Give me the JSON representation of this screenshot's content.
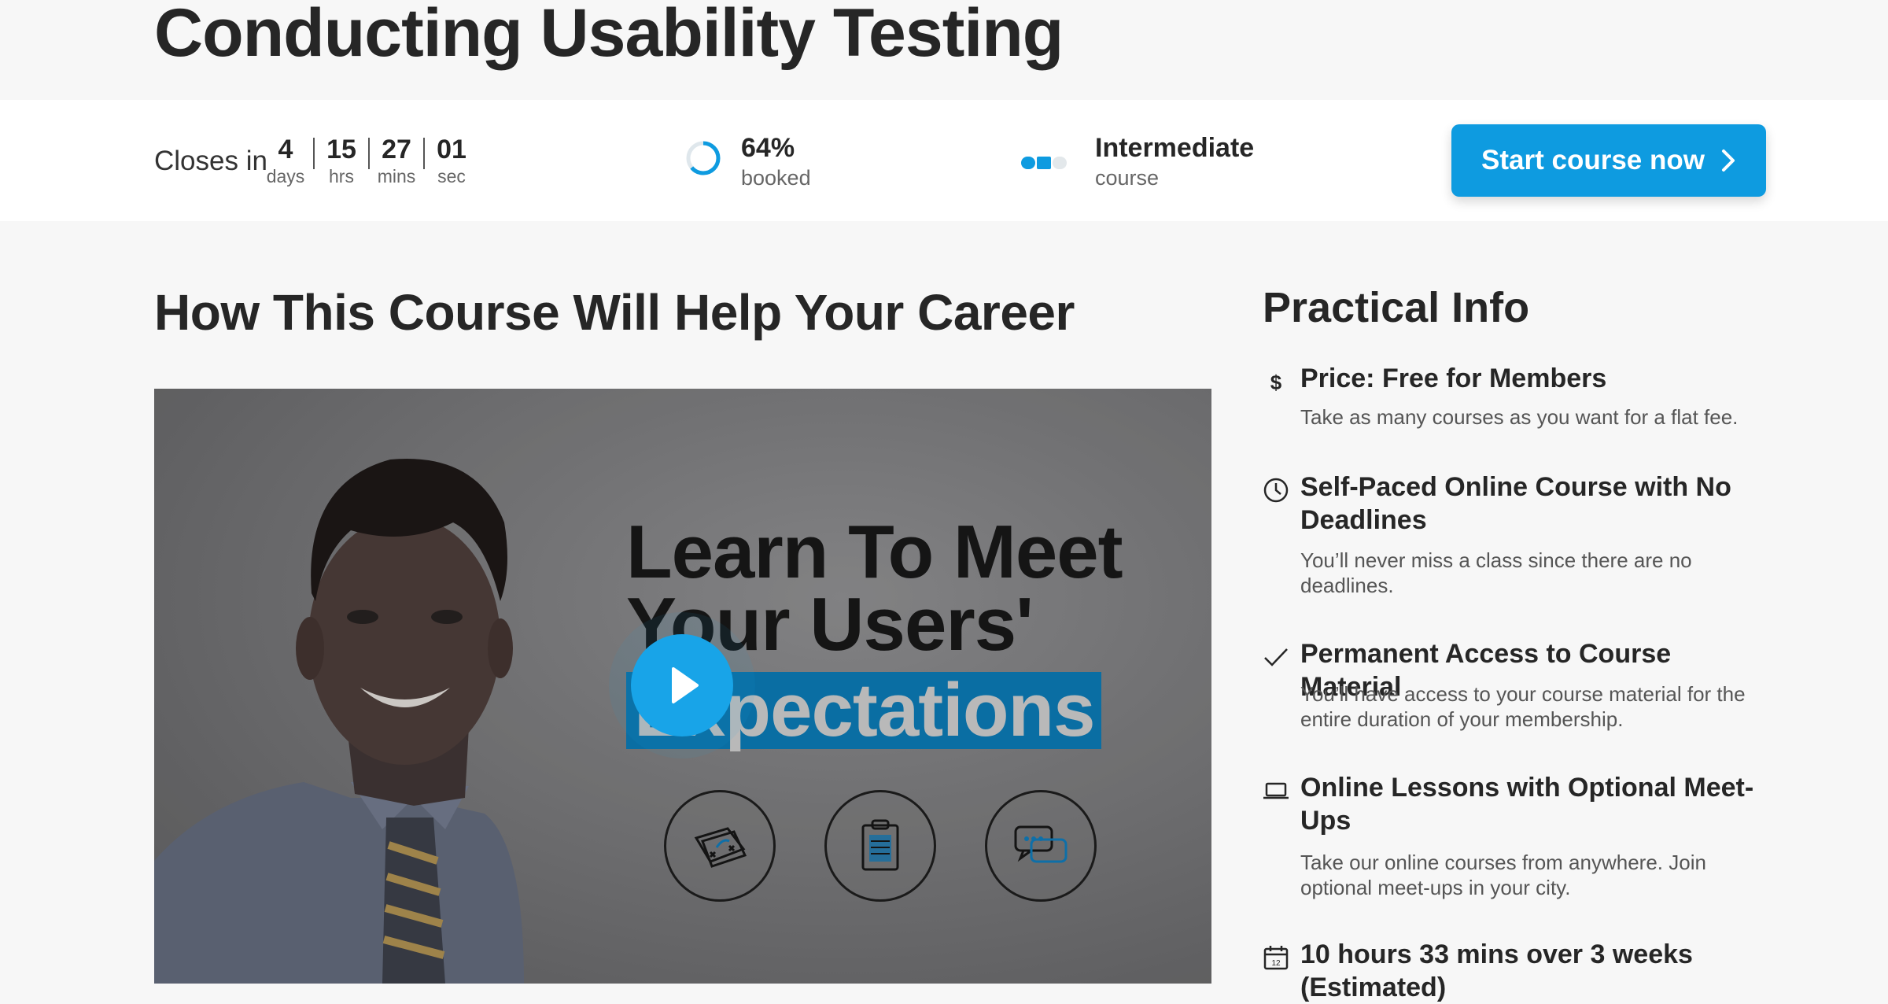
{
  "page": {
    "title": "Conducting Usability Testing"
  },
  "status_bar": {
    "closes_label": "Closes in",
    "countdown": [
      {
        "value": "4",
        "unit": "days"
      },
      {
        "value": "15",
        "unit": "hrs"
      },
      {
        "value": "27",
        "unit": "mins"
      },
      {
        "value": "01",
        "unit": "sec"
      }
    ],
    "booked": {
      "value": "64%",
      "label": "booked",
      "fraction": 0.64
    },
    "level": {
      "value": "Intermediate",
      "label": "course",
      "filled_segments": 2,
      "total_segments": 3
    },
    "start_button": {
      "label": "Start course now",
      "icon": "chevron-right-icon"
    }
  },
  "main": {
    "heading": "How This Course Will Help Your Career",
    "video": {
      "line1": "Learn To Meet",
      "line2": "Your Users'",
      "line3": "Expectations",
      "play_icon": "play-icon",
      "feature_icons": [
        "map-icon",
        "clipboard-icon",
        "chat-icon"
      ]
    }
  },
  "practical_info": {
    "heading": "Practical Info",
    "items": [
      {
        "icon": "dollar-icon",
        "title": "Price: Free for Members",
        "desc": "Take as many courses as you want for a flat fee."
      },
      {
        "icon": "clock-icon",
        "title": "Self-Paced Online Course with No Deadlines",
        "desc": "You’ll never miss a class since there are no deadlines."
      },
      {
        "icon": "checkmark-icon",
        "title": "Permanent Access to Course Material",
        "desc": "You’ll have access to your course material for the entire duration of your membership."
      },
      {
        "icon": "laptop-icon",
        "title": "Online Lessons with Optional Meet-Ups",
        "desc": "Take our online courses from anywhere. Join optional meet-ups in your city."
      },
      {
        "icon": "calendar-icon",
        "title": "10 hours 33 mins over 3 weeks (Estimated)",
        "desc": ""
      }
    ]
  },
  "colors": {
    "accent": "#0e9be0",
    "page_bg": "#f7f7f7",
    "text": "#262626"
  }
}
